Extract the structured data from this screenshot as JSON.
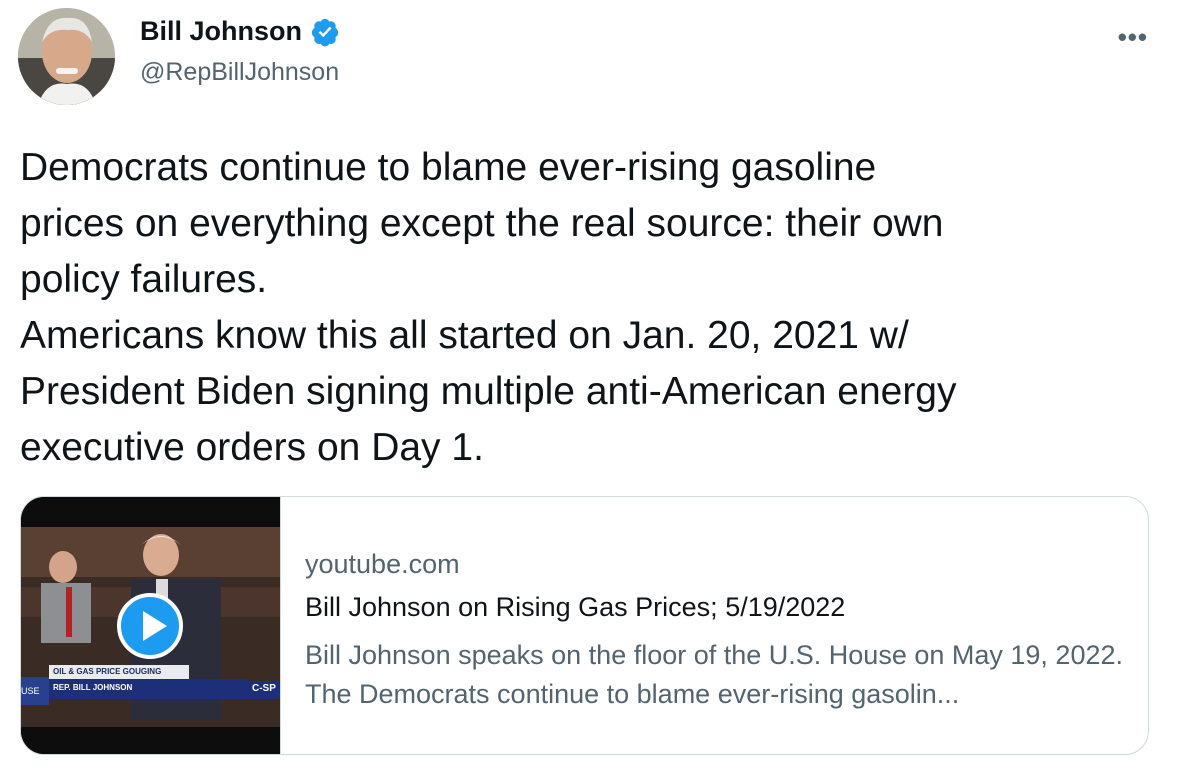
{
  "author": {
    "name": "Bill Johnson",
    "handle": "@RepBillJohnson",
    "verified": true,
    "avatar_icon": "profile-photo"
  },
  "more_label": "•••",
  "tweet": {
    "text": "Democrats continue to blame ever-rising gasoline\nprices on everything except the real source: their own\npolicy failures.\nAmericans know this all started on Jan. 20, 2021 w/\nPresident Biden signing multiple anti-American energy\nexecutive orders on Day 1."
  },
  "card": {
    "domain": "youtube.com",
    "title": "Bill Johnson on Rising Gas Prices; 5/19/2022",
    "description": "Bill Johnson speaks on the floor of the U.S. House on May 19, 2022. The Democrats continue to blame ever-rising gasolin...",
    "thumbnail": {
      "chyron_top": "OIL & GAS PRICE GOUGING",
      "chyron_bottom": "REP. BILL JOHNSON",
      "network": "C-SP",
      "badge": "USE"
    }
  },
  "colors": {
    "accent": "#1d9bf0",
    "text_primary": "#0f1419",
    "text_secondary": "#536471",
    "border": "#cfd9de"
  }
}
